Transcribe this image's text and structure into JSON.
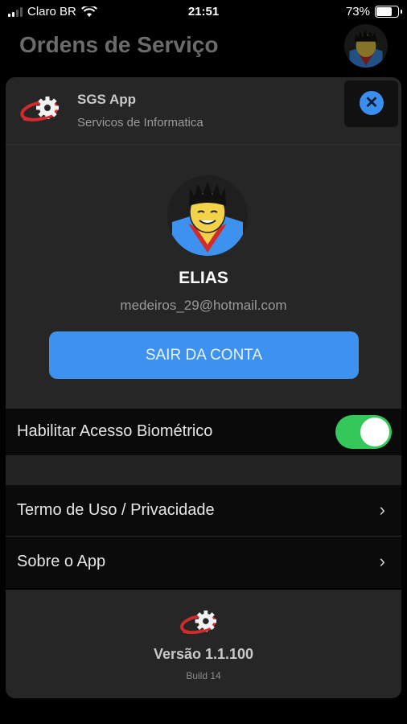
{
  "status_bar": {
    "carrier": "Claro BR",
    "time": "21:51",
    "battery_percent": "73%",
    "battery_level": 0.73,
    "signal_bars_active": 2,
    "signal_bars_total": 4
  },
  "header": {
    "title": "Ordens de Serviço"
  },
  "sheet": {
    "app_name": "SGS App",
    "app_subtitle": "Servicos de Informatica",
    "user_name": "ELIAS",
    "user_email": "medeiros_29@hotmail.com",
    "logout_label": "SAIR DA CONTA"
  },
  "settings": {
    "biometric_label": "Habilitar Acesso Biométrico",
    "biometric_enabled": true,
    "items": [
      {
        "label": "Termo de Uso / Privacidade"
      },
      {
        "label": "Sobre o App"
      }
    ]
  },
  "footer": {
    "version": "Versão 1.1.100",
    "build": "Build 14"
  },
  "colors": {
    "accent_blue": "#3d92f0",
    "toggle_green": "#34c759",
    "sheet_bg": "#262626",
    "logo_red": "#d32b2b"
  },
  "icons": [
    "signal-icon",
    "wifi-icon",
    "battery-icon",
    "sgs-logo-icon",
    "close-icon",
    "avatar-icon",
    "chevron-right-icon"
  ]
}
